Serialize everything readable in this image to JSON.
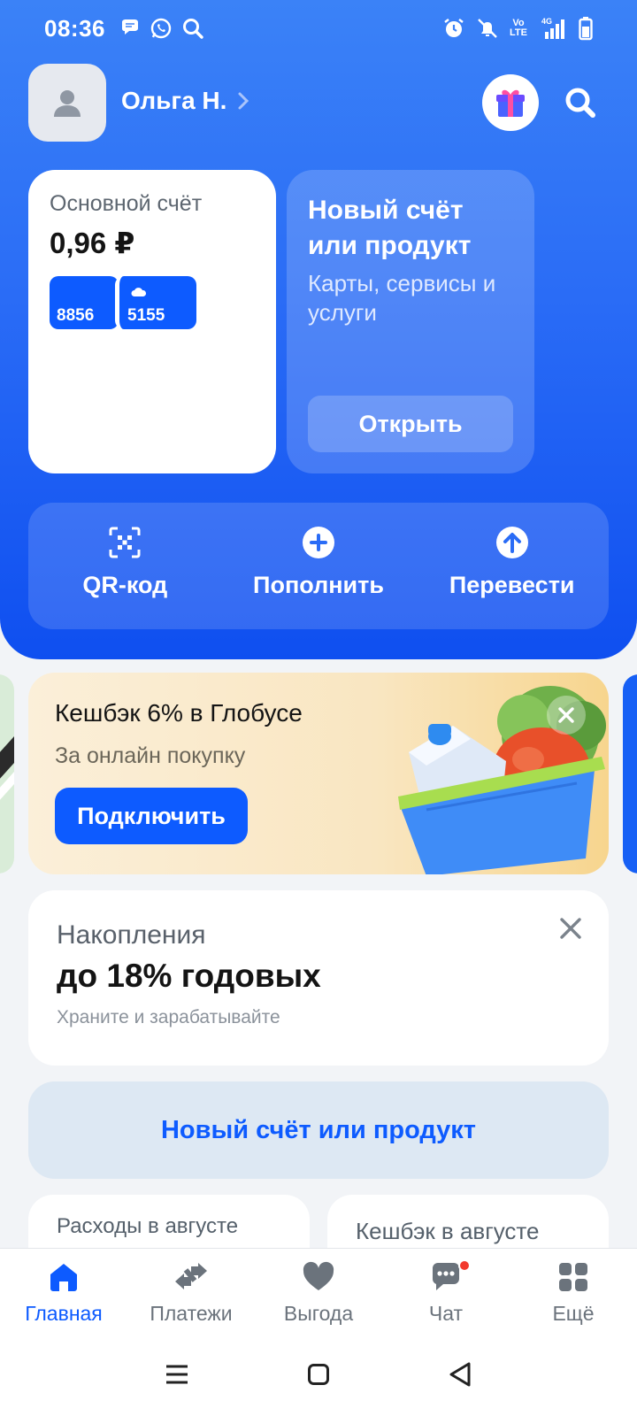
{
  "status_bar": {
    "time": "08:36",
    "lte_top": "Vo",
    "lte_bottom": "LTE",
    "network": "4G"
  },
  "header": {
    "user_name": "Ольга Н."
  },
  "main_account": {
    "label": "Основной счёт",
    "balance": "0,96 ₽",
    "card1": "8856",
    "card2": "5155"
  },
  "new_product_card": {
    "title": "Новый счёт или продукт",
    "subtitle": "Карты, сервисы и услуги",
    "button": "Открыть"
  },
  "actions": [
    {
      "label": "QR-код",
      "icon": "qr-scan-icon"
    },
    {
      "label": "Пополнить",
      "icon": "plus-circle-icon"
    },
    {
      "label": "Перевести",
      "icon": "arrow-up-circle-icon"
    }
  ],
  "promo_banner": {
    "title": "Кешбэк 6% в Глобусе",
    "subtitle": "За онлайн покупку",
    "button": "Подключить"
  },
  "savings": {
    "title": "Накопления",
    "headline": "до 18% годовых",
    "subtitle": "Храните и зарабатывайте"
  },
  "new_product_button": {
    "label": "Новый счёт или продукт"
  },
  "summary_cards": {
    "expenses": "Расходы в августе",
    "cashback": "Кешбэк в августе"
  },
  "tabs": [
    {
      "label": "Главная",
      "icon": "home-icon",
      "active": true
    },
    {
      "label": "Платежи",
      "icon": "transfer-arrows-icon",
      "active": false
    },
    {
      "label": "Выгода",
      "icon": "heart-icon",
      "active": false
    },
    {
      "label": "Чат",
      "icon": "chat-icon",
      "active": false,
      "has_badge": true
    },
    {
      "label": "Ещё",
      "icon": "grid-icon",
      "active": false
    }
  ],
  "colors": {
    "brand_blue": "#0d5bff",
    "header_gradient_top": "#3b82f7",
    "header_gradient_bottom": "#0f4ff0",
    "badge_red": "#f23a2e"
  }
}
